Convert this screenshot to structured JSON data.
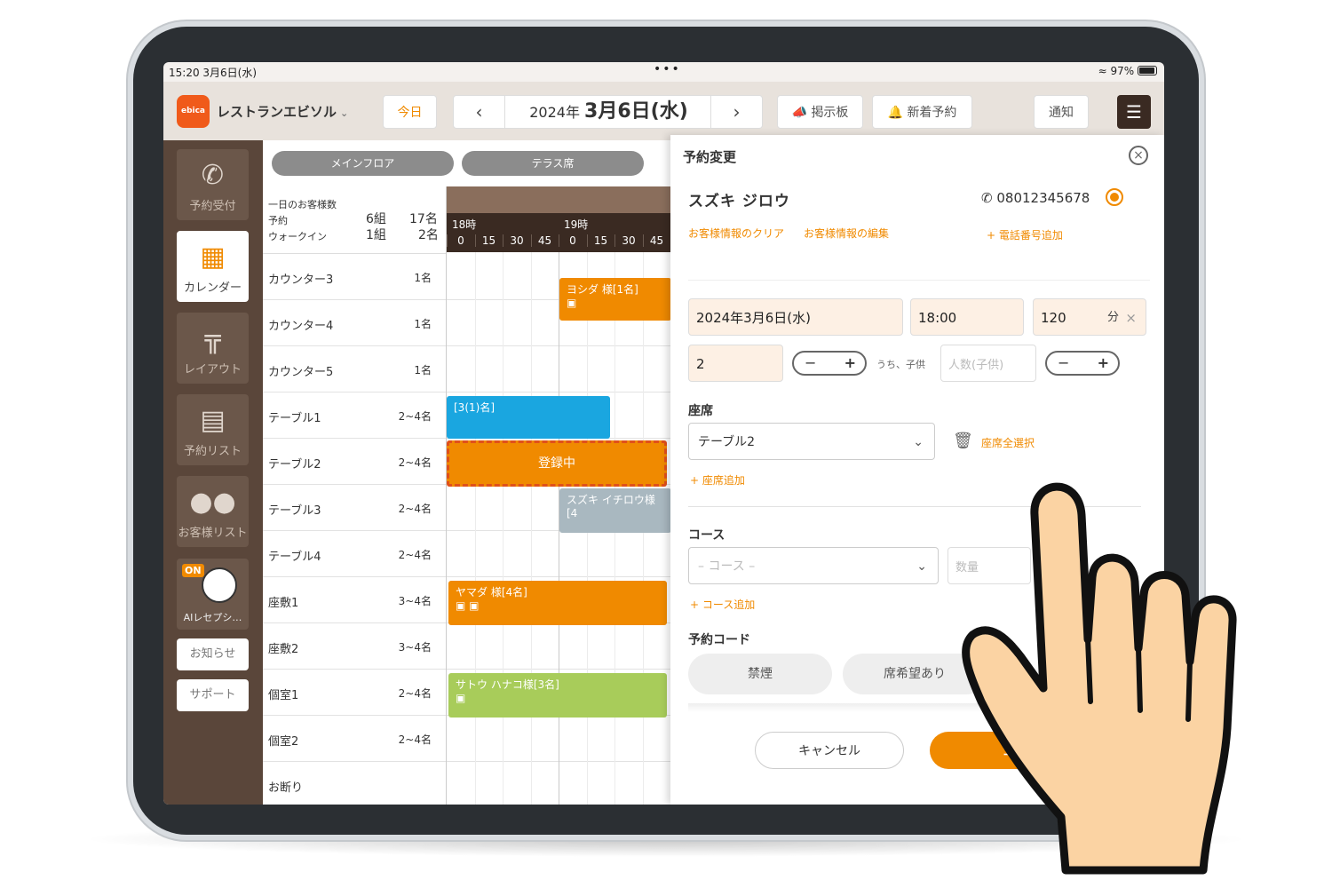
{
  "status_bar": {
    "time": "15:20 3月6日(水)",
    "dots": "•••",
    "battery": "97%"
  },
  "header": {
    "logo": "ebica",
    "restaurant": "レストランエビソル",
    "today": "今日",
    "date_year": "2024年",
    "date_md": "3月6日(水)",
    "board": "掲示板",
    "new_reservation": "新着予約",
    "notice": "通知"
  },
  "sidebar": {
    "items": [
      {
        "label": "予約受付",
        "icon": "phone-icon"
      },
      {
        "label": "カレンダー",
        "icon": "calendar-icon"
      },
      {
        "label": "レイアウト",
        "icon": "table-layout-icon"
      },
      {
        "label": "予約リスト",
        "icon": "book-icon"
      },
      {
        "label": "お客様リスト",
        "icon": "people-icon"
      }
    ],
    "ai_badge": "ON",
    "ai_label": "AIレセプシ…",
    "news": "お知らせ",
    "support": "サポート"
  },
  "floor": {
    "tabs": [
      "メインフロア",
      "テラス席"
    ],
    "summary": {
      "title": "一日のお客様数",
      "reserve_label": "予約",
      "reserve_groups": "6組",
      "reserve_people": "17名",
      "walkin_label": "ウォークイン",
      "walkin_groups": "1組",
      "walkin_people": "2名"
    },
    "hours": [
      "18時",
      "19時"
    ],
    "minutes": [
      "0",
      "15",
      "30",
      "45",
      "0",
      "15",
      "30",
      "45"
    ],
    "rows": [
      {
        "name": "カウンター3",
        "cap": "1名"
      },
      {
        "name": "カウンター4",
        "cap": "1名"
      },
      {
        "name": "カウンター5",
        "cap": "1名"
      },
      {
        "name": "テーブル1",
        "cap": "2~4名"
      },
      {
        "name": "テーブル2",
        "cap": "2~4名"
      },
      {
        "name": "テーブル3",
        "cap": "2~4名"
      },
      {
        "name": "テーブル4",
        "cap": "2~4名"
      },
      {
        "name": "座敷1",
        "cap": "3~4名"
      },
      {
        "name": "座敷2",
        "cap": "3~4名"
      },
      {
        "name": "個室1",
        "cap": "2~4名"
      },
      {
        "name": "個室2",
        "cap": "2~4名"
      },
      {
        "name": "お断り",
        "cap": ""
      }
    ],
    "bookings": {
      "yoshida": "ヨシダ 様[1名]",
      "walkin": "[3(1)名]",
      "registering": "登録中",
      "suzuki": "スズキ イチロウ様[4",
      "yamada": "ヤマダ 様[4名]",
      "sato": "サトウ ハナコ様[3名]"
    }
  },
  "panel": {
    "title": "予約変更",
    "customer_name": "スズキ ジロウ",
    "phone": "08012345678",
    "clear_link": "お客様情報のクリア",
    "edit_link": "お客様情報の編集",
    "add_phone": "電話番号追加",
    "date": "2024年3月6日(水)",
    "time": "18:00",
    "duration": "120",
    "duration_unit": "分",
    "people": "2",
    "children_label": "うち、子供",
    "children_placeholder": "人数(子供)",
    "seat_heading": "座席",
    "seat_value": "テーブル2",
    "clear_seats": "座席全選択",
    "add_seat": "座席追加",
    "course_heading": "コース",
    "course_placeholder": "– コース –",
    "qty_placeholder": "数量",
    "add_course": "コース追加",
    "code_heading": "予約コード",
    "codes": [
      "禁煙",
      "席希望あり"
    ],
    "cancel": "キャンセル",
    "register": "登"
  },
  "colors": {
    "accent": "#f08a00",
    "sidebar": "#5a463a",
    "blue": "#1aa6e0",
    "green": "#a8cc5a",
    "gray": "#a9b8c0"
  }
}
